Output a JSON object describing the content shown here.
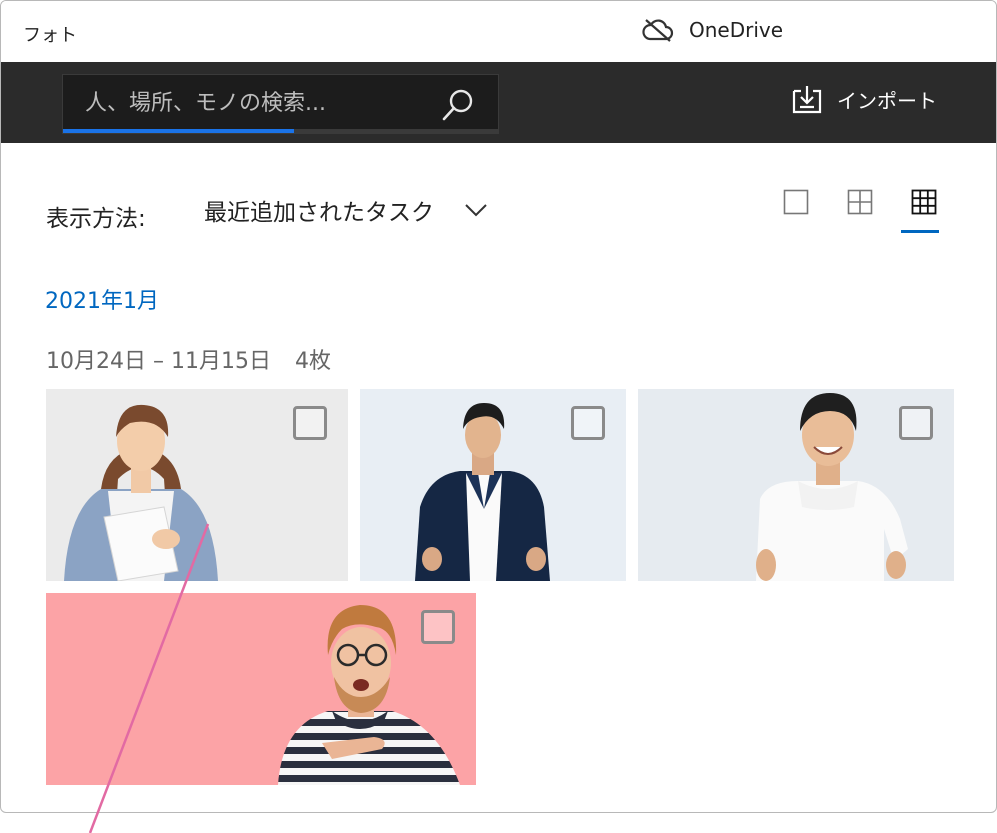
{
  "app": {
    "title": "フォト"
  },
  "onedrive": {
    "label": "OneDrive",
    "icon": "cloud-off-icon"
  },
  "search": {
    "placeholder": "人、場所、モノの検索...",
    "progress_fraction": 0.53
  },
  "toolbar": {
    "import_label": "インポート",
    "import_icon": "import-icon"
  },
  "view": {
    "label": "表示方法:",
    "selected": "最近追加されたタスク",
    "toggles": [
      {
        "icon": "single-view-icon",
        "active": false
      },
      {
        "icon": "medium-grid-icon",
        "active": false
      },
      {
        "icon": "small-grid-icon",
        "active": true
      }
    ]
  },
  "collection": {
    "month": "2021年1月",
    "date_range": "10月24日 – 11月15日",
    "count": "4枚",
    "photos": [
      {
        "subject": "woman-cardigan",
        "bg": "#ebebeb",
        "checked": false
      },
      {
        "subject": "man-navy-blazer",
        "bg": "#e8eef4",
        "checked": false
      },
      {
        "subject": "man-white-tshirt",
        "bg": "#e6ebf0",
        "checked": false
      },
      {
        "subject": "man-striped-shirt",
        "bg": "#fca3a6",
        "checked": false
      }
    ]
  },
  "colors": {
    "accent": "#0067c0",
    "toolbar": "#2b2b2b",
    "annotation": "#e26aa3"
  }
}
